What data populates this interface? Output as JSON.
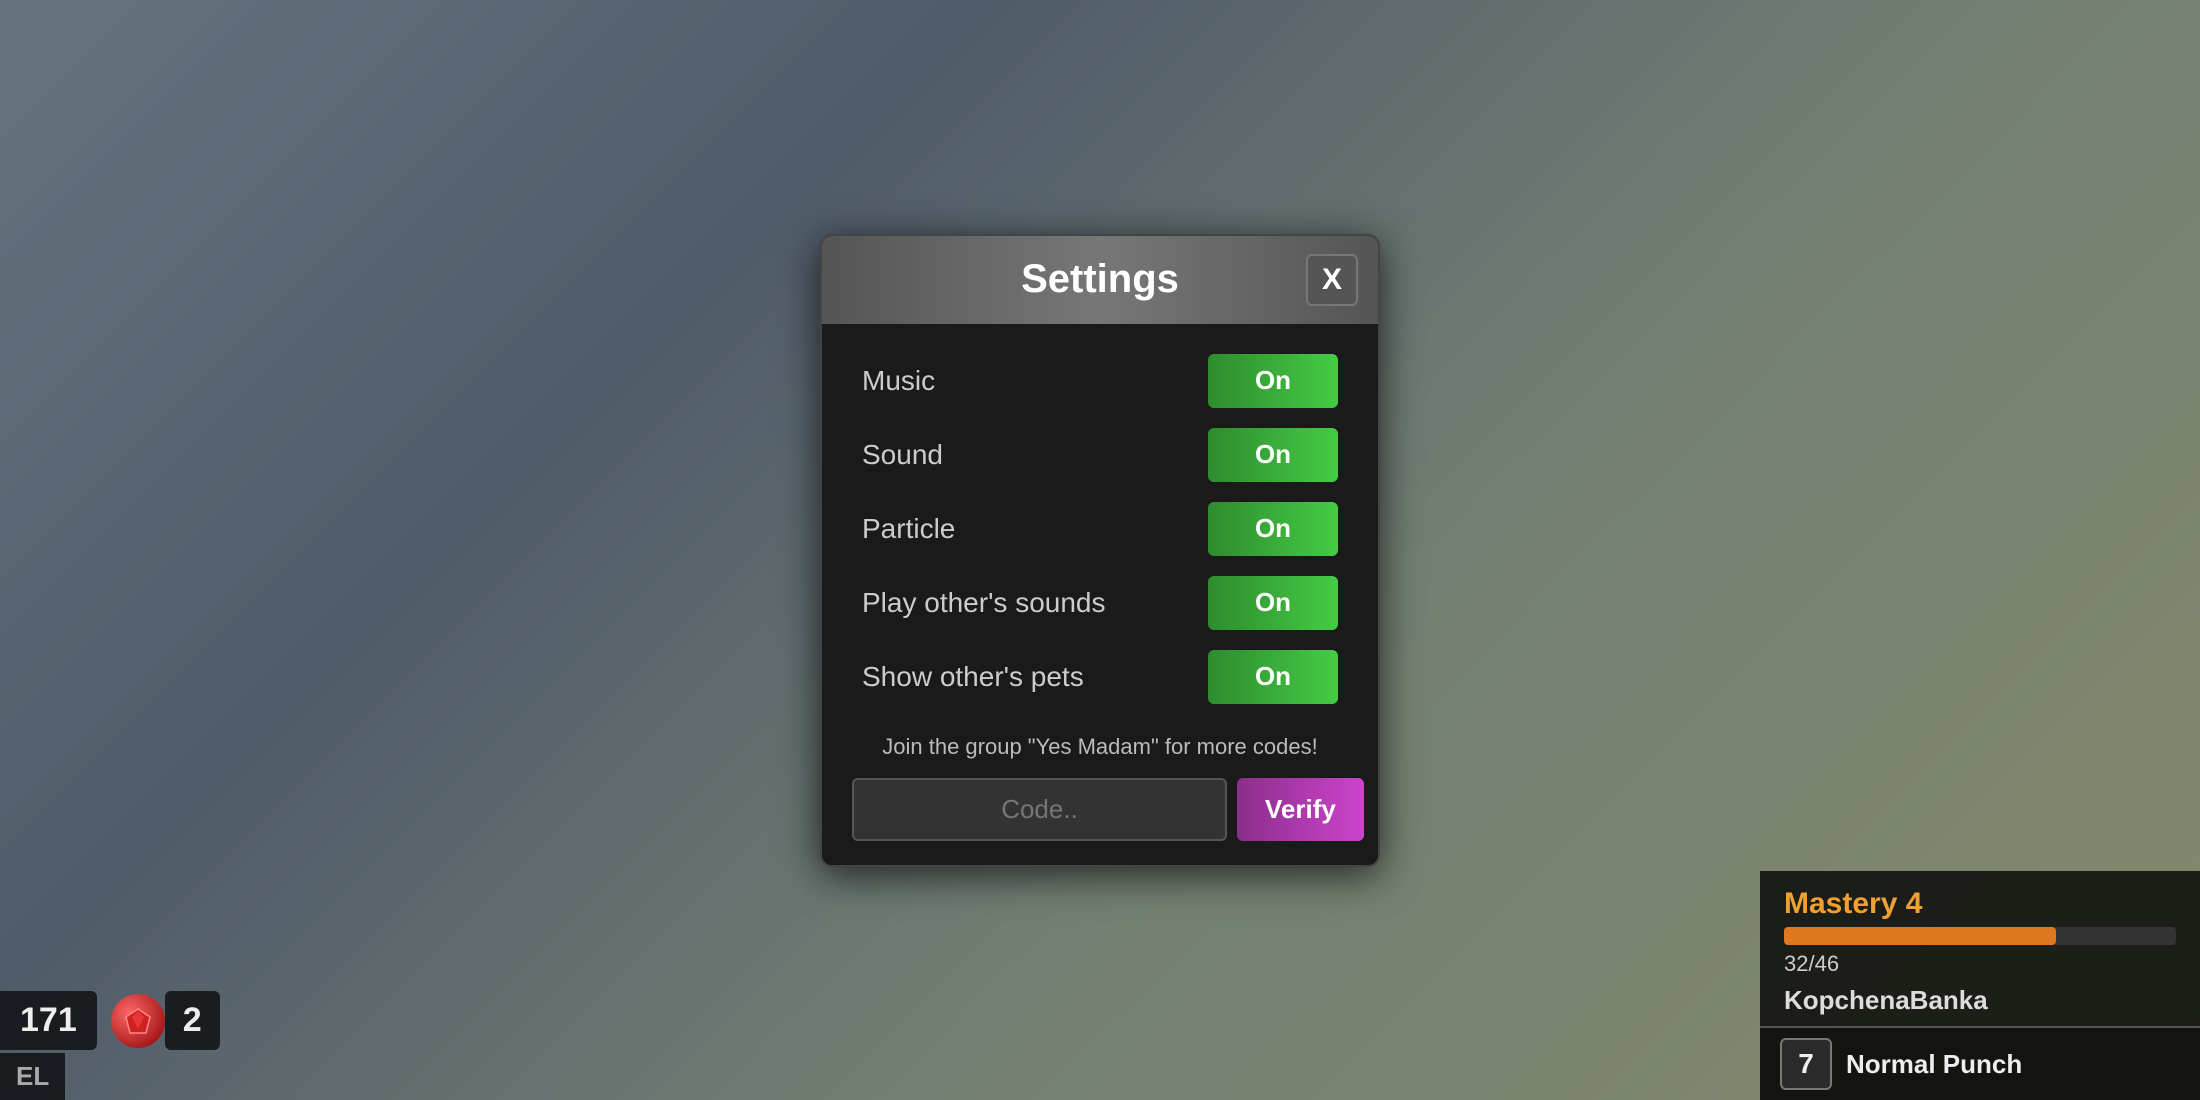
{
  "background": {
    "description": "blurred city street background"
  },
  "hud": {
    "coins": "171",
    "gems": "2",
    "level_label": "EL",
    "mastery_label": "Mastery 4",
    "mastery_current": 32,
    "mastery_max": 46,
    "mastery_text": "32/46",
    "player_name": "KopchenaBanka",
    "normal_punch_key": "7",
    "normal_punch_label": "Normal Punch"
  },
  "modal": {
    "title": "Settings",
    "close_label": "X",
    "settings": [
      {
        "label": "Music",
        "value": "On"
      },
      {
        "label": "Sound",
        "value": "On"
      },
      {
        "label": "Particle",
        "value": "On"
      },
      {
        "label": "Play other's sounds",
        "value": "On"
      },
      {
        "label": "Show other's pets",
        "value": "On"
      }
    ],
    "promo_text": "Join the group \"Yes Madam\" for more codes!",
    "code_placeholder": "Code..",
    "verify_label": "Verify"
  }
}
